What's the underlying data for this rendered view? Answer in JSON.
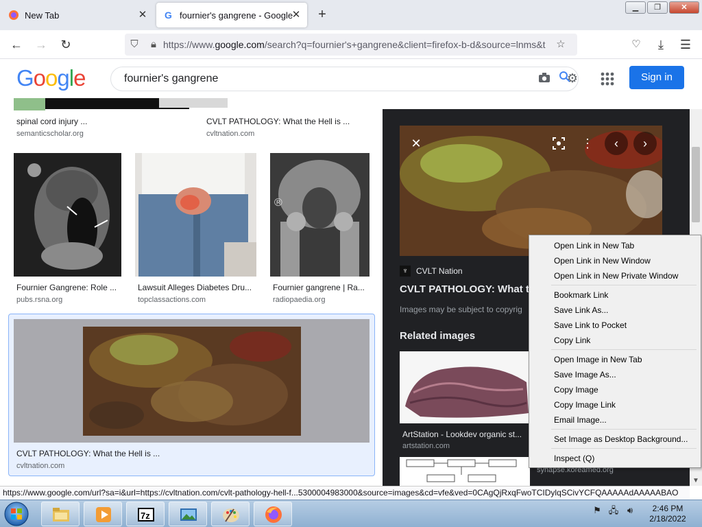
{
  "browser": {
    "tabs": [
      {
        "title": "New Tab"
      },
      {
        "title": "fournier's gangrene - Google Se"
      }
    ],
    "url_prefix": "https://www.",
    "url_domain": "google.com",
    "url_rest": "/search?q=fournier's+gangrene&client=firefox-b-d&source=lnms&t",
    "status_url": "https://www.google.com/url?sa=i&url=https://cvltnation.com/cvlt-pathology-hell-f...5300004983000&source=images&cd=vfe&ved=0CAgQjRxqFwoTCIDylqSCivYCFQAAAAAdAAAAABAO"
  },
  "google": {
    "logo": "Google",
    "query": "fournier's gangrene",
    "signin": "Sign in"
  },
  "results": {
    "row0": [
      {
        "title": "spinal cord injury ...",
        "source": "semanticscholar.org"
      },
      {
        "title": "CVLT PATHOLOGY: What the Hell is ...",
        "source": "cvltnation.com"
      }
    ],
    "row1": [
      {
        "title": "Fournier Gangrene: Role ...",
        "source": "pubs.rsna.org"
      },
      {
        "title": "Lawsuit Alleges Diabetes Dru...",
        "source": "topclassactions.com"
      },
      {
        "title": "Fournier gangrene | Ra...",
        "source": "radiopaedia.org"
      }
    ],
    "selected": {
      "title": "CVLT PATHOLOGY: What the Hell is ...",
      "source": "cvltnation.com"
    },
    "xray_mark": "®"
  },
  "preview": {
    "site": "CVLT Nation",
    "title": "CVLT PATHOLOGY: What the",
    "note": "Images may be subject to copyrig",
    "related_heading": "Related images",
    "related": [
      {
        "title": "ArtStation - Lookdev organic st...",
        "source": "artstation.com"
      },
      {
        "title": "",
        "source": "synapse.koreamed.org"
      }
    ]
  },
  "context_menu": {
    "groups": [
      [
        "Open Link in New Tab",
        "Open Link in New Window",
        "Open Link in New Private Window"
      ],
      [
        "Bookmark Link",
        "Save Link As...",
        "Save Link to Pocket",
        "Copy Link"
      ],
      [
        "Open Image in New Tab",
        "Save Image As...",
        "Copy Image",
        "Copy Image Link",
        "Email Image..."
      ],
      [
        "Set Image as Desktop Background..."
      ],
      [
        "Inspect (Q)"
      ]
    ]
  },
  "taskbar": {
    "time": "2:46 PM",
    "date": "2/18/2022",
    "apps": [
      "file-explorer",
      "media-player",
      "7zip",
      "image-viewer",
      "paint",
      "firefox"
    ]
  },
  "colors": {
    "accent": "#1a73e8",
    "preview_bg": "#202124",
    "menu_bg": "#f0f0f0"
  }
}
